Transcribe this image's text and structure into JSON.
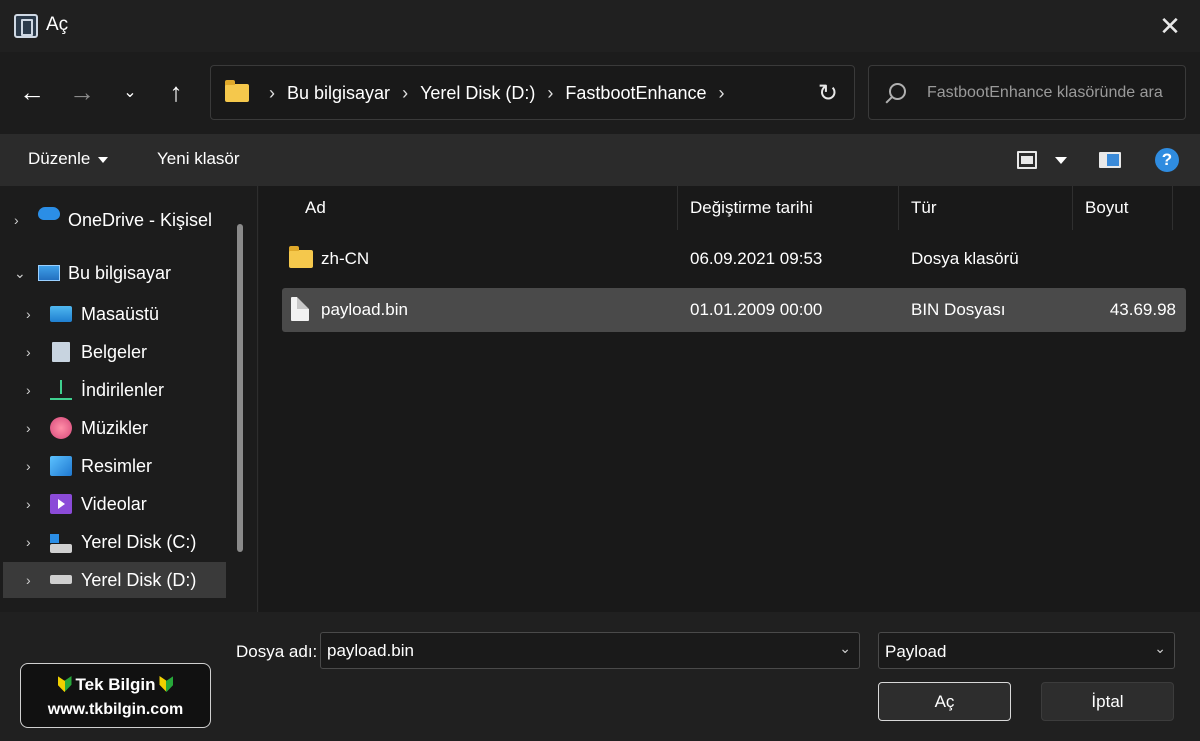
{
  "window": {
    "title": "Aç",
    "close_icon": "close-icon"
  },
  "nav": {
    "back_icon": "arrow-left-icon",
    "forward_icon": "arrow-right-icon",
    "recent_icon": "chevron-down-icon",
    "up_icon": "arrow-up-icon"
  },
  "address": {
    "crumbs": [
      "Bu bilgisayar",
      "Yerel Disk (D:)",
      "FastbootEnhance"
    ],
    "refresh_icon": "refresh-icon"
  },
  "search": {
    "placeholder": "FastbootEnhance klasöründe ara"
  },
  "commandbar": {
    "organize_label": "Düzenle",
    "new_folder_label": "Yeni klasör"
  },
  "sidebar": {
    "items": [
      {
        "label": "OneDrive - Kişisel",
        "icon": "cloud-icon"
      },
      {
        "label": "Bu bilgisayar",
        "icon": "computer-icon"
      },
      {
        "label": "Masaüstü",
        "icon": "desktop-icon"
      },
      {
        "label": "Belgeler",
        "icon": "documents-icon"
      },
      {
        "label": "İndirilenler",
        "icon": "download-icon"
      },
      {
        "label": "Müzikler",
        "icon": "music-icon"
      },
      {
        "label": "Resimler",
        "icon": "pictures-icon"
      },
      {
        "label": "Videolar",
        "icon": "videos-icon"
      },
      {
        "label": "Yerel Disk (C:)",
        "icon": "drive-c-icon"
      },
      {
        "label": "Yerel Disk (D:)",
        "icon": "drive-icon"
      }
    ]
  },
  "filelist": {
    "columns": {
      "name": "Ad",
      "modified": "Değiştirme tarihi",
      "type": "Tür",
      "size": "Boyut"
    },
    "rows": [
      {
        "name": "zh-CN",
        "modified": "06.09.2021 09:53",
        "type": "Dosya klasörü",
        "size": ""
      },
      {
        "name": "payload.bin",
        "modified": "01.01.2009 00:00",
        "type": "BIN Dosyası",
        "size": "43.69.98"
      }
    ]
  },
  "bottom": {
    "filename_label": "Dosya adı:",
    "filename_value": "payload.bin",
    "filetype_value": "Payload",
    "open_label": "Aç",
    "cancel_label": "İptal"
  },
  "watermark": {
    "line1": "Tek Bilgin",
    "line2": "www.tkbilgin.com"
  }
}
